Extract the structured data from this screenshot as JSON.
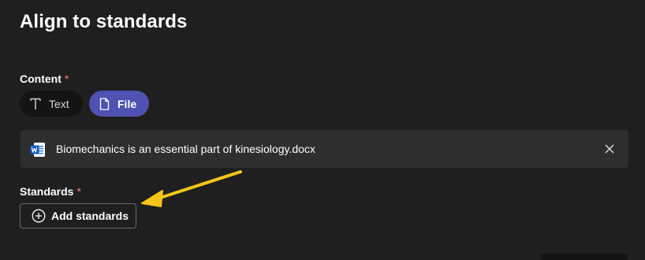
{
  "page": {
    "title": "Align to standards"
  },
  "content_section": {
    "label": "Content",
    "required_mark": "*",
    "options": [
      {
        "label": "Text",
        "icon": "text-icon",
        "selected": false
      },
      {
        "label": "File",
        "icon": "file-icon",
        "selected": true
      }
    ]
  },
  "attached_file": {
    "name": "Biomechanics is an essential part of kinesiology.docx",
    "icon": "word-doc-icon"
  },
  "standards_section": {
    "label": "Standards",
    "required_mark": "*",
    "add_button_label": "Add standards"
  },
  "colors": {
    "background": "#1f1f1f",
    "accent": "#4f52b2",
    "required": "#ff7a7a",
    "annotation_arrow": "#f5c518"
  }
}
